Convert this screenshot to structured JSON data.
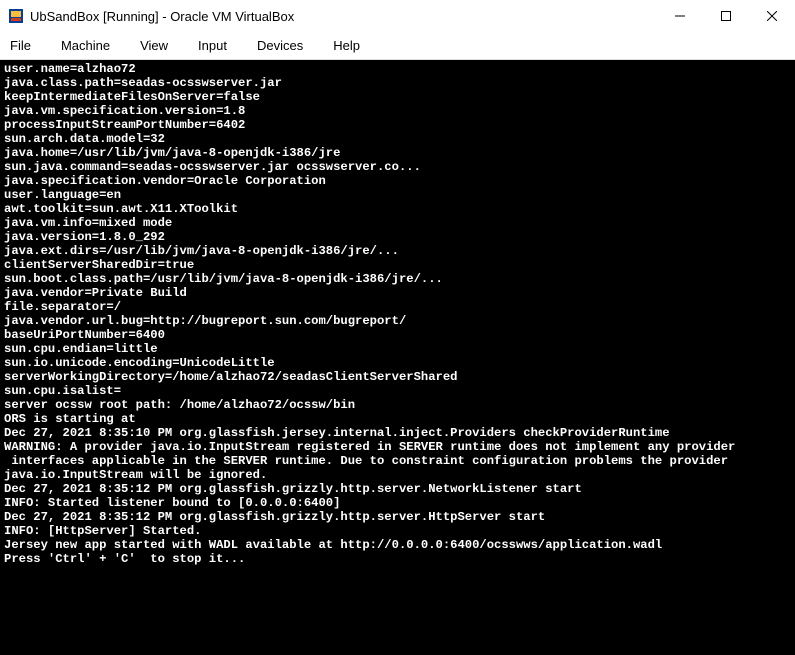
{
  "window": {
    "title": "UbSandBox [Running] - Oracle VM VirtualBox"
  },
  "menu": {
    "items": [
      "File",
      "Machine",
      "View",
      "Input",
      "Devices",
      "Help"
    ]
  },
  "terminal": {
    "lines": [
      "user.name=alzhao72",
      "java.class.path=seadas-ocsswserver.jar",
      "keepIntermediateFilesOnServer=false",
      "java.vm.specification.version=1.8",
      "processInputStreamPortNumber=6402",
      "sun.arch.data.model=32",
      "java.home=/usr/lib/jvm/java-8-openjdk-i386/jre",
      "sun.java.command=seadas-ocsswserver.jar ocsswserver.co...",
      "java.specification.vendor=Oracle Corporation",
      "user.language=en",
      "awt.toolkit=sun.awt.X11.XToolkit",
      "java.vm.info=mixed mode",
      "java.version=1.8.0_292",
      "java.ext.dirs=/usr/lib/jvm/java-8-openjdk-i386/jre/...",
      "clientServerSharedDir=true",
      "sun.boot.class.path=/usr/lib/jvm/java-8-openjdk-i386/jre/...",
      "java.vendor=Private Build",
      "file.separator=/",
      "java.vendor.url.bug=http://bugreport.sun.com/bugreport/",
      "baseUriPortNumber=6400",
      "sun.cpu.endian=little",
      "sun.io.unicode.encoding=UnicodeLittle",
      "serverWorkingDirectory=/home/alzhao72/seadasClientServerShared",
      "sun.cpu.isalist=",
      "server ocssw root path: /home/alzhao72/ocssw/bin",
      "ORS is starting at",
      "Dec 27, 2021 8:35:10 PM org.glassfish.jersey.internal.inject.Providers checkProviderRuntime",
      "WARNING: A provider java.io.InputStream registered in SERVER runtime does not implement any provider",
      " interfaces applicable in the SERVER runtime. Due to constraint configuration problems the provider ",
      "java.io.InputStream will be ignored.",
      "Dec 27, 2021 8:35:12 PM org.glassfish.grizzly.http.server.NetworkListener start",
      "INFO: Started listener bound to [0.0.0.0:6400]",
      "Dec 27, 2021 8:35:12 PM org.glassfish.grizzly.http.server.HttpServer start",
      "INFO: [HttpServer] Started.",
      "Jersey new app started with WADL available at http://0.0.0.0:6400/ocsswws/application.wadl",
      "Press 'Ctrl' + 'C'  to stop it..."
    ]
  }
}
